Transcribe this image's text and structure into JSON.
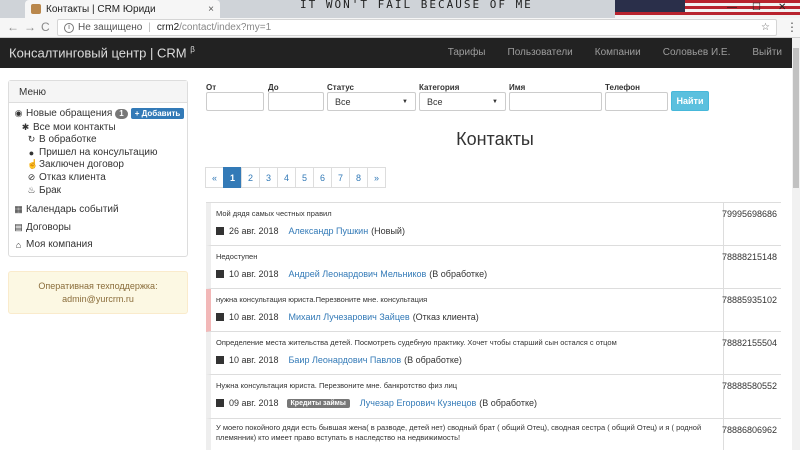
{
  "browser": {
    "tab_title": "Контакты | CRM Юриди",
    "tab_close": "×",
    "decor_text": "IT WON'T FAIL BECAUSE OF ME",
    "window_controls": [
      "—",
      "☐",
      "✕"
    ],
    "nav": {
      "back": "←",
      "forward": "→",
      "reload": "C"
    },
    "security_text": "Не защищено",
    "url_host": "crm2",
    "url_path": "/contact/index?my=1",
    "bookmark": "☆",
    "menu": "⋮"
  },
  "navbar": {
    "brand": "Консалтинговый центр | CRM",
    "brand_sup": "β",
    "links": [
      "Тарифы",
      "Пользователи",
      "Компании",
      "Соловьев И.Е.",
      "Выйти"
    ]
  },
  "sidebar": {
    "menu_title": "Меню",
    "new_requests": {
      "label": "Новые обращения",
      "count": "1",
      "add_label": "+ Добавить"
    },
    "sub_items": [
      {
        "icon": "asterisk-icon",
        "label": "Все мои контакты"
      },
      {
        "icon": "refresh-icon",
        "label": "В обработке"
      },
      {
        "icon": "user-icon",
        "label": "Пришел на консультацию"
      },
      {
        "icon": "thumbs-up-icon",
        "label": "Заключен договор"
      },
      {
        "icon": "ban-icon",
        "label": "Отказ клиента"
      },
      {
        "icon": "fire-icon",
        "label": "Брак"
      }
    ],
    "items": [
      {
        "icon": "calendar-icon",
        "label": "Календарь событий"
      },
      {
        "icon": "book-icon",
        "label": "Договоры"
      },
      {
        "icon": "home-icon",
        "label": "Моя компания"
      }
    ],
    "support": {
      "title": "Оперативная техподдержка:",
      "email": "admin@yurcrm.ru"
    }
  },
  "filters": {
    "from_label": "От",
    "to_label": "До",
    "status_label": "Статус",
    "status_value": "Все",
    "category_label": "Категория",
    "category_value": "Все",
    "name_label": "Имя",
    "phone_label": "Телефон",
    "find_button": "Найти"
  },
  "page_title": "Контакты",
  "pagination": [
    "«",
    "1",
    "2",
    "3",
    "4",
    "5",
    "6",
    "7",
    "8",
    "»"
  ],
  "contacts": [
    {
      "comment": "Мой дядя самых честных правил",
      "date": "26 авг. 2018",
      "label": "",
      "name": "Александр Пушкин",
      "status": "(Новый)",
      "phone": "79995698686"
    },
    {
      "comment": "Недоступен",
      "date": "10 авг. 2018",
      "label": "",
      "name": "Андрей Леонардович Мельников",
      "status": "(В обработке)",
      "phone": "78888215148"
    },
    {
      "comment": "нужна консультация юриста.Перезвоните мне. консультация",
      "date": "10 авг. 2018",
      "label": "",
      "name": "Михаил Лучезарович Зайцев",
      "status": "(Отказ клиента)",
      "phone": "78885935102"
    },
    {
      "comment": "Определение места жительства детей. Посмотреть судебную практику. Хочет чтобы старший сын остался с отцом",
      "date": "10 авг. 2018",
      "label": "",
      "name": "Баир Леонардович Павлов",
      "status": "(В обработке)",
      "phone": "78882155504"
    },
    {
      "comment": "Нужна консультация юриста. Перезвоните мне. банкротство физ лиц",
      "date": "09 авг. 2018",
      "label": "Кредиты займы",
      "name": "Лучезар Егорович Кузнецов",
      "status": "(В обработке)",
      "phone": "78888580552"
    },
    {
      "comment": "У моего покойного дяди есть бывшая жена( в разводе, детей нет) сводный брат ( общий Отец), сводная сестра ( общий Отец) и я ( родной племянник) кто имеет право вступать в наследство на недвижимость!",
      "date": "",
      "label": "",
      "name": "",
      "status": "",
      "phone": "78886806962"
    }
  ]
}
